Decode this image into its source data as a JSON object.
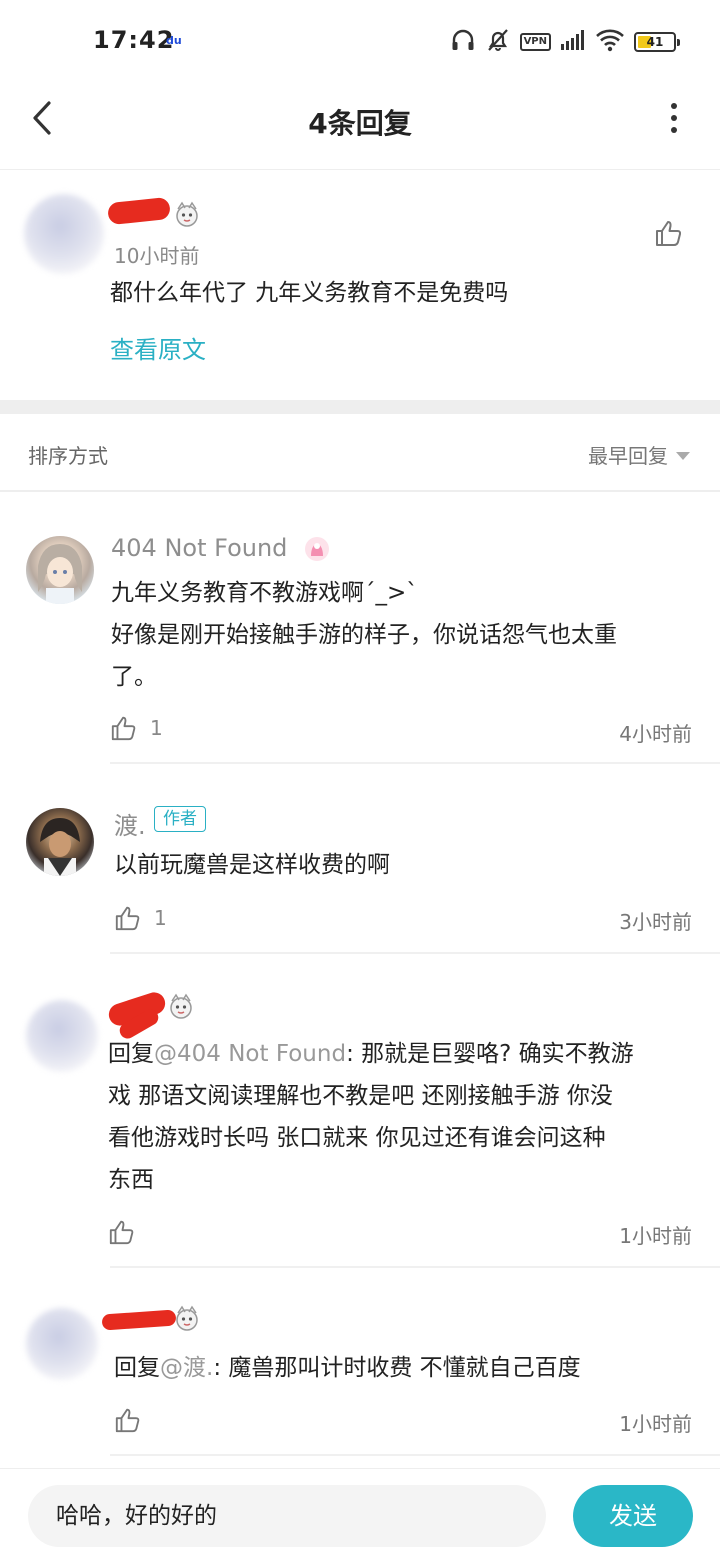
{
  "status_bar": {
    "time": "17:42",
    "carrier_badge": "du",
    "vpn": "VPN",
    "battery": "41",
    "battery_level": 0.41,
    "icons": [
      "headset-icon",
      "mute-bell-icon",
      "vpn-icon",
      "signal-icon",
      "wifi-icon",
      "battery-icon"
    ]
  },
  "header": {
    "title": "4条回复"
  },
  "original": {
    "time": "10小时前",
    "text": "都什么年代了 九年义务教育不是免费吗",
    "view_original": "查看原文"
  },
  "sort": {
    "label": "排序方式",
    "selected": "最早回复"
  },
  "replies": [
    {
      "username": "404 Not Found",
      "lines": [
        "九年义务教育不教游戏啊ˊ_>ˋ",
        "好像是刚开始接触手游的样子，你说话怨气也太重",
        "了。"
      ],
      "likes": "1",
      "time": "4小时前"
    },
    {
      "username": "渡.",
      "author_tag": "作者",
      "lines": [
        "以前玩魔兽是这样收费的啊"
      ],
      "likes": "1",
      "time": "3小时前"
    },
    {
      "reply_prefix": "回复",
      "mention": "@404 Not Found",
      "line1_rest": ": 那就是巨婴咯? 确实不教游",
      "lines": [
        "戏 那语文阅读理解也不教是吧 还刚接触手游 你没",
        "看他游戏时长吗 张口就来 你见过还有谁会问这种",
        "东西"
      ],
      "likes": "",
      "time": "1小时前"
    },
    {
      "reply_prefix": "回复",
      "mention": "@渡.",
      "line1_rest": ": 魔兽那叫计时收费  不懂就自己百度",
      "likes": "",
      "time": "1小时前"
    }
  ],
  "input": {
    "value": "哈哈，好的好的",
    "send_label": "发送"
  },
  "colors": {
    "accent": "#2ab7c7",
    "redaction": "#e62b1f",
    "text_primary": "#222222",
    "text_secondary": "#8e8e8e"
  }
}
